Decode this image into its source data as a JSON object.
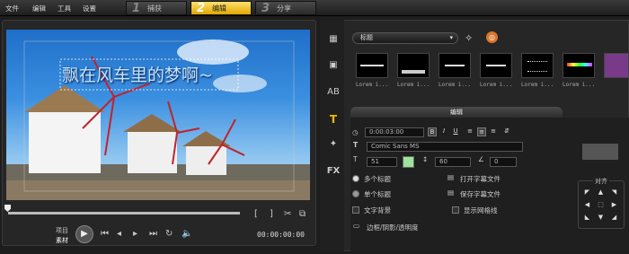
{
  "menu": {
    "file": "文件",
    "edit": "编辑",
    "tools": "工具",
    "settings": "设置"
  },
  "steps": [
    {
      "num": "1",
      "label": "捕获"
    },
    {
      "num": "2",
      "label": "编辑"
    },
    {
      "num": "3",
      "label": "分享"
    }
  ],
  "preview": {
    "title_text": "飘在风车里的梦啊~"
  },
  "player": {
    "mode_project": "项目",
    "mode_clip": "素材",
    "timecode": "00:00:00:00"
  },
  "library": {
    "dropdown": "标题",
    "thumb_label": "Lorem i..."
  },
  "edit": {
    "tab": "编辑",
    "duration": "0:00:03:00",
    "font": "Comic Sans MS",
    "font_size": "51",
    "line_spacing": "60",
    "angle": "0",
    "multi_title": "多个标题",
    "single_title": "单个标题",
    "text_bg": "文字背景",
    "show_grid": "显示网格线",
    "open_file": "打开字幕文件",
    "save_file": "保存字幕文件",
    "border_shadow": "边框/阴影/透明度",
    "align": "对齐"
  },
  "colors": {
    "accent": "#f0b800",
    "text_color": "#9de39b",
    "title_text": "#bfe8ff"
  }
}
